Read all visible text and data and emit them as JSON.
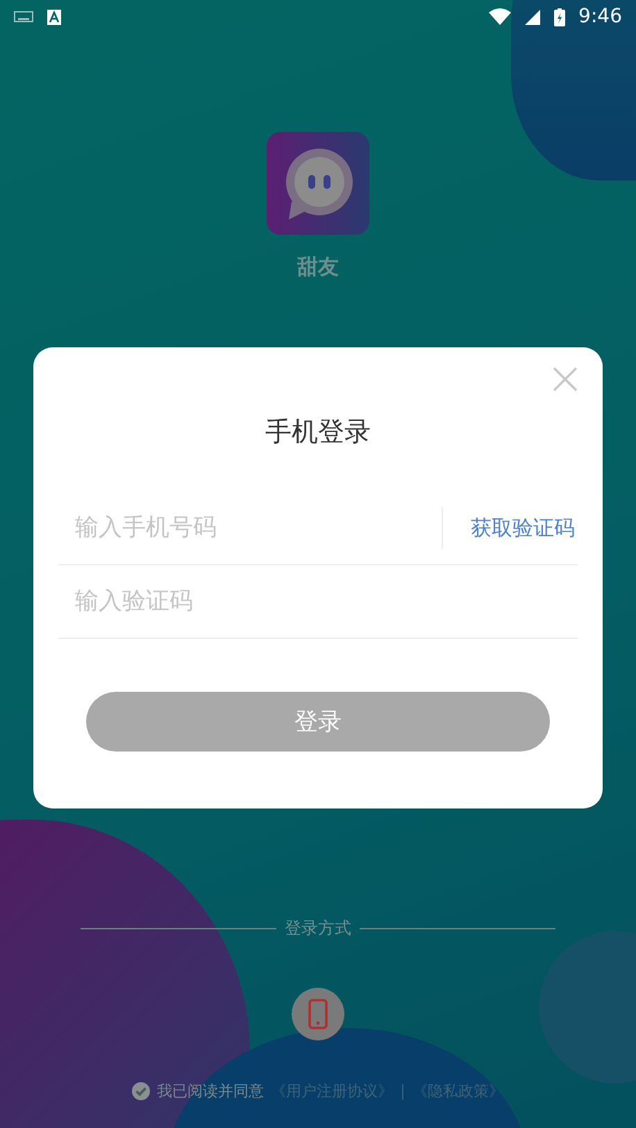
{
  "status_bar": {
    "time": "9:46"
  },
  "app": {
    "name": "甜友"
  },
  "dialog": {
    "title": "手机登录",
    "phone_field": {
      "placeholder": "输入手机号码"
    },
    "get_code_button": "获取验证码",
    "code_field": {
      "placeholder": "输入验证码"
    },
    "login_button": {
      "label": "登录",
      "disabled": true
    }
  },
  "login_methods": {
    "label": "登录方式"
  },
  "agreement": {
    "checked": true,
    "text": "我已阅读并同意",
    "links": [
      "《用户注册协议》",
      "《隐私政策》"
    ],
    "separator": "|"
  }
}
